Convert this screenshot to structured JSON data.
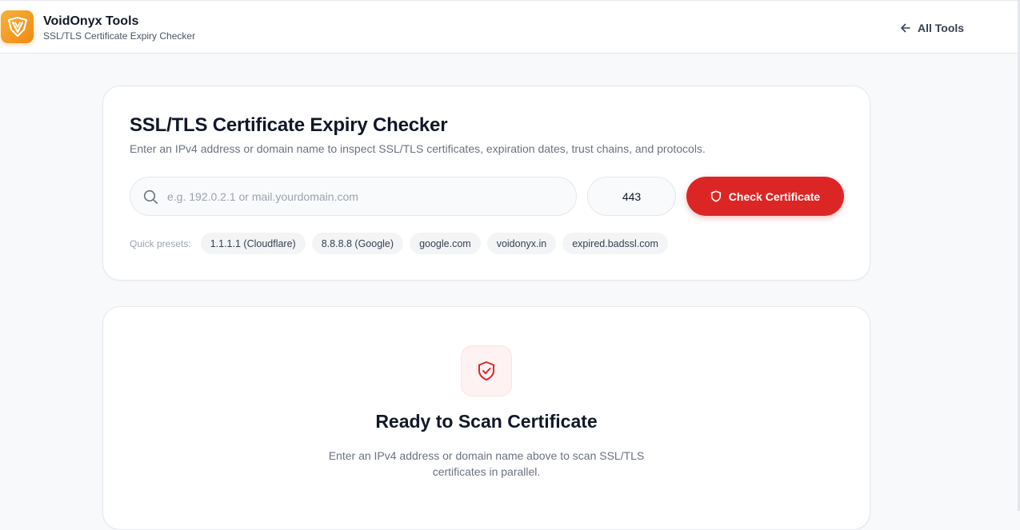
{
  "header": {
    "brand_name": "VoidOnyx Tools",
    "brand_subtitle": "SSL/TLS Certificate Expiry Checker",
    "all_tools_label": "All Tools",
    "logo_icon": "shield-v-logo-icon",
    "accent_color": "#f08a12"
  },
  "search_card": {
    "title": "SSL/TLS Certificate Expiry Checker",
    "description": "Enter an IPv4 address or domain name to inspect SSL/TLS certificates, expiration dates, trust chains, and protocols.",
    "host_input": {
      "value": "",
      "placeholder": "e.g. 192.0.2.1 or mail.yourdomain.com"
    },
    "port_input": {
      "value": "443"
    },
    "check_button_label": "Check Certificate",
    "button_color": "#dc2626",
    "presets_label": "Quick presets:",
    "presets": [
      "1.1.1.1 (Cloudflare)",
      "8.8.8.8 (Google)",
      "google.com",
      "voidonyx.in",
      "expired.badssl.com"
    ]
  },
  "ready_card": {
    "icon": "shield-check-icon",
    "title": "Ready to Scan Certificate",
    "description": "Enter an IPv4 address or domain name above to scan SSL/TLS certificates in parallel."
  }
}
